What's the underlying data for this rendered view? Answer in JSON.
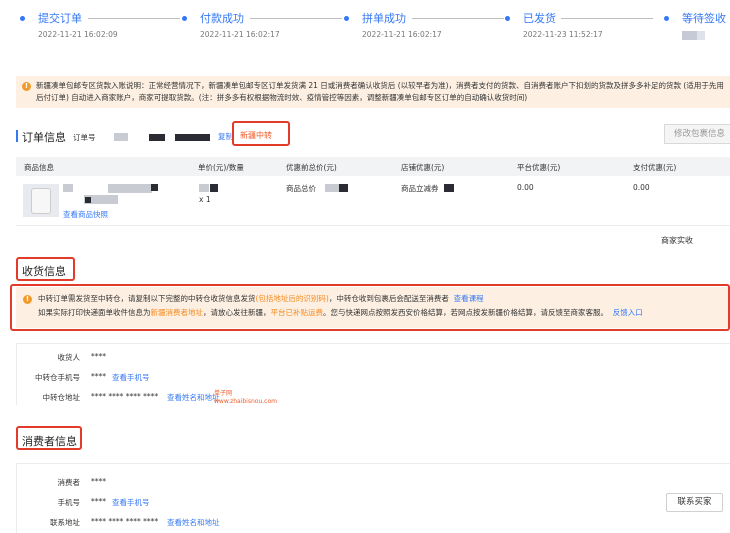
{
  "steps": [
    {
      "label": "提交订单",
      "time": "2022-11-21 16:02:09"
    },
    {
      "label": "付款成功",
      "time": "2022-11-21 16:02:17"
    },
    {
      "label": "拼单成功",
      "time": "2022-11-21 16:02:17"
    },
    {
      "label": "已发货",
      "time": "2022-11-23 11:52:17"
    },
    {
      "label": "等待签收",
      "time": ""
    }
  ],
  "notice": {
    "text": "新疆凑单包邮专区货款入账说明：正常经营情况下，新疆凑单包邮专区订单发货满 21 日或消费者确认收货后 (以较早者为准)，消费者支付的货款、自消费者账户下扣划的货款及拼多多补足的货款 (适用于先用后付订单) 自动进入商家账户，商家可提取货款。(注：拼多多有权根据物流时效、疫情管控等因素，调整新疆凑单包邮专区订单的自动确认收货时间)"
  },
  "order_info": {
    "title": "订单信息",
    "order_no_label": "订单号",
    "copy": "复制",
    "tag": "新疆中转",
    "modify_button": "修改包裹信息"
  },
  "table": {
    "headers": [
      "商品信息",
      "单价(元)/数量",
      "优惠前总价(元)",
      "店铺优惠(元)",
      "平台优惠(元)",
      "支付优惠(元)"
    ],
    "row": {
      "snapshot_link": "查看商品快照",
      "quantity": "x 1",
      "total_label": "商品总价",
      "shop_discount_label": "商品立减券",
      "platform_discount": "0.00",
      "pay_discount": "0.00"
    },
    "merchant_received": "商家实收"
  },
  "receive": {
    "title": "收货信息",
    "notice_line1_a": "中转订单需发货至中转仓，请复制以下完整的中转仓收货信息发货",
    "notice_line1_b": "(包括地址后的识别码)",
    "notice_line1_c": "，中转仓收到包裹后会配送至消费者",
    "notice_line1_link": "查看课程",
    "notice_line2_a": "如果实际打印快递面单收件信息为",
    "notice_line2_b": "新疆消费者地址",
    "notice_line2_c": "，请放心发往新疆，",
    "notice_line2_d": "平台已补贴运费",
    "notice_line2_e": "。您与快递网点按照发西安价格结算，若网点按发新疆价格结算，请反馈至商家客服。",
    "notice_line2_link": "反馈入口",
    "fields": [
      {
        "label": "收货人",
        "value": "****",
        "link": ""
      },
      {
        "label": "中转仓手机号",
        "value": "****",
        "link": "查看手机号"
      },
      {
        "label": "中转仓地址",
        "value": "**** **** **** ****",
        "link": "查看姓名和地址"
      }
    ]
  },
  "watermark": {
    "line1": "单子网",
    "line2": "www.zhaibisnou.com"
  },
  "consumer": {
    "title": "消费者信息",
    "fields": [
      {
        "label": "消费者",
        "value": "****",
        "link": ""
      },
      {
        "label": "手机号",
        "value": "****",
        "link": "查看手机号"
      },
      {
        "label": "联系地址",
        "value": "**** **** **** ****",
        "link": "查看姓名和地址"
      }
    ],
    "contact_button": "联系买家"
  },
  "colors": {
    "accent": "#3478f6",
    "highlight": "#e23b2a",
    "warning_bg": "#fdf0e3",
    "orange": "#f58a1e"
  }
}
